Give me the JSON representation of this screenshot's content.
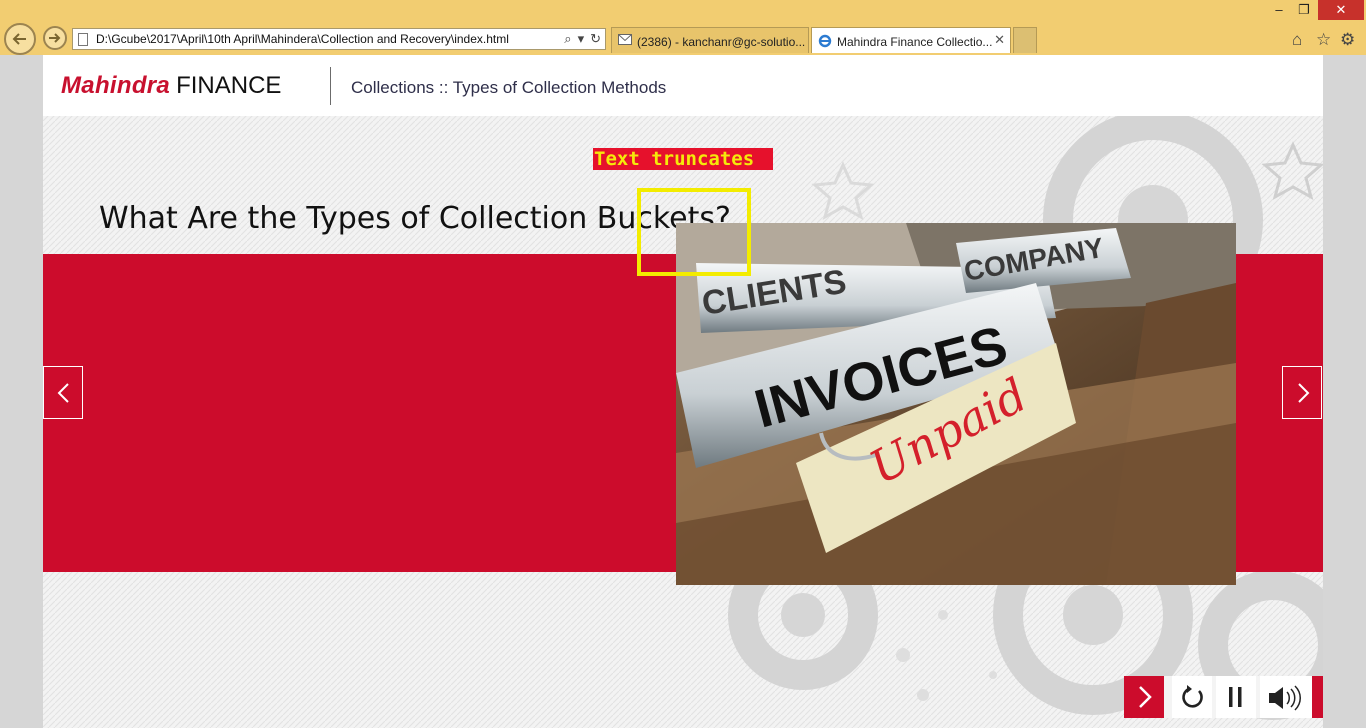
{
  "browser": {
    "url": "D:\\Gcube\\2017\\April\\10th April\\Mahindera\\Collection and Recovery\\index.html",
    "tabs": [
      {
        "label": "(2386) - kanchanr@gc-solutio...",
        "icon": "mail-icon"
      },
      {
        "label": "Mahindra Finance Collectio...",
        "icon": "ie-icon",
        "active": true
      }
    ],
    "window_controls": {
      "minimize": "–",
      "restore": "❐",
      "close": "✕"
    },
    "close_tab": "✕"
  },
  "header": {
    "logo_brand": "Mahindra",
    "logo_suffix": "FINANCE",
    "breadcrumb": "Collections :: Types of Collection Methods"
  },
  "slide": {
    "question": "What Are the Types of Collection Buckets?",
    "photo_texts": {
      "tab1": "CLIENTS",
      "tab2": "COMPANY",
      "tab3": "INVOICES",
      "note": "Unpaid"
    },
    "band_color": "#cc0c2c"
  },
  "annotation": {
    "label": "Text truncates",
    "label_bg": "#e6112c",
    "label_color": "#f5e90a",
    "box_color": "#f3ec00"
  },
  "controls": {
    "icons": [
      "next-icon",
      "replay-icon",
      "pause-icon",
      "audio-icon"
    ]
  }
}
